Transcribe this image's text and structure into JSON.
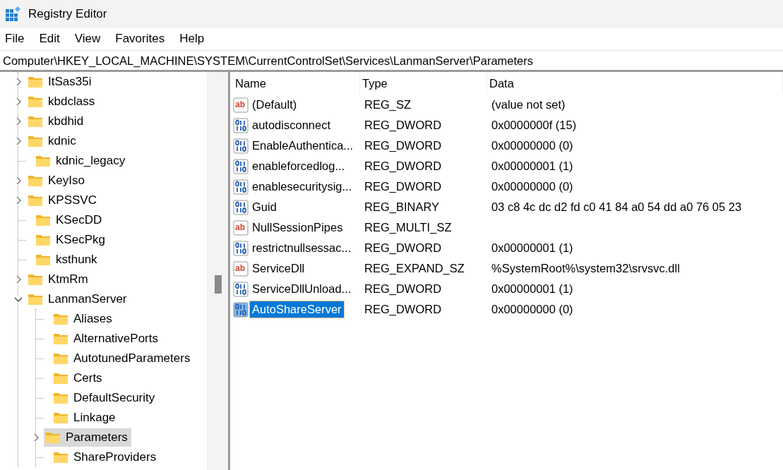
{
  "window": {
    "title": "Registry Editor"
  },
  "menu": [
    "File",
    "Edit",
    "View",
    "Favorites",
    "Help"
  ],
  "address": "Computer\\HKEY_LOCAL_MACHINE\\SYSTEM\\CurrentControlSet\\Services\\LanmanServer\\Parameters",
  "tree": [
    {
      "label": "ItSas35i",
      "has_children": true,
      "expanded": false,
      "selected": false
    },
    {
      "label": "kbdclass",
      "has_children": true,
      "expanded": false,
      "selected": false
    },
    {
      "label": "kbdhid",
      "has_children": true,
      "expanded": false,
      "selected": false
    },
    {
      "label": "kdnic",
      "has_children": true,
      "expanded": false,
      "selected": false
    },
    {
      "label": "kdnic_legacy",
      "has_children": false,
      "expanded": false,
      "selected": false
    },
    {
      "label": "KeyIso",
      "has_children": true,
      "expanded": false,
      "selected": false
    },
    {
      "label": "KPSSVC",
      "has_children": true,
      "expanded": false,
      "selected": false
    },
    {
      "label": "KSecDD",
      "has_children": false,
      "expanded": false,
      "selected": false
    },
    {
      "label": "KSecPkg",
      "has_children": false,
      "expanded": false,
      "selected": false
    },
    {
      "label": "ksthunk",
      "has_children": false,
      "expanded": false,
      "selected": false
    },
    {
      "label": "KtmRm",
      "has_children": true,
      "expanded": false,
      "selected": false
    },
    {
      "label": "LanmanServer",
      "has_children": true,
      "expanded": true,
      "selected": false,
      "children": [
        {
          "label": "Aliases",
          "has_children": false,
          "expanded": false,
          "selected": false
        },
        {
          "label": "AlternativePorts",
          "has_children": false,
          "expanded": false,
          "selected": false
        },
        {
          "label": "AutotunedParameters",
          "has_children": false,
          "expanded": false,
          "selected": false
        },
        {
          "label": "Certs",
          "has_children": false,
          "expanded": false,
          "selected": false
        },
        {
          "label": "DefaultSecurity",
          "has_children": false,
          "expanded": false,
          "selected": false
        },
        {
          "label": "Linkage",
          "has_children": false,
          "expanded": false,
          "selected": false
        },
        {
          "label": "Parameters",
          "has_children": true,
          "expanded": false,
          "selected": true
        },
        {
          "label": "ShareProviders",
          "has_children": false,
          "expanded": false,
          "selected": false
        }
      ]
    }
  ],
  "values": {
    "columns": [
      "Name",
      "Type",
      "Data"
    ],
    "rows": [
      {
        "kind": "string",
        "icon_label": "ab",
        "name": "(Default)",
        "type": "REG_SZ",
        "data": "(value not set)",
        "selected": false
      },
      {
        "kind": "binary",
        "name": "autodisconnect",
        "type": "REG_DWORD",
        "data": "0x0000000f (15)",
        "selected": false
      },
      {
        "kind": "binary",
        "name": "EnableAuthentica...",
        "type": "REG_DWORD",
        "data": "0x00000000 (0)",
        "selected": false
      },
      {
        "kind": "binary",
        "name": "enableforcedlog...",
        "type": "REG_DWORD",
        "data": "0x00000001 (1)",
        "selected": false
      },
      {
        "kind": "binary",
        "name": "enablesecuritysig...",
        "type": "REG_DWORD",
        "data": "0x00000000 (0)",
        "selected": false
      },
      {
        "kind": "binary",
        "name": "Guid",
        "type": "REG_BINARY",
        "data": "03 c8 4c dc d2 fd c0 41 84 a0 54 dd a0 76 05 23",
        "selected": false
      },
      {
        "kind": "string",
        "icon_label": "ab",
        "name": "NullSessionPipes",
        "type": "REG_MULTI_SZ",
        "selected": false
      },
      {
        "kind": "binary",
        "name": "restrictnullsessac...",
        "type": "REG_DWORD",
        "data": "0x00000001 (1)",
        "selected": false
      },
      {
        "kind": "string",
        "icon_label": "ab",
        "name": "ServiceDll",
        "type": "REG_EXPAND_SZ",
        "data": "%SystemRoot%\\system32\\srvsvc.dll",
        "selected": false
      },
      {
        "kind": "binary",
        "name": "ServiceDllUnload...",
        "type": "REG_DWORD",
        "data": "0x00000001 (1)",
        "selected": false
      },
      {
        "kind": "binary",
        "name": "AutoShareServer",
        "type": "REG_DWORD",
        "data": "0x00000000 (0)",
        "selected": true
      }
    ]
  }
}
